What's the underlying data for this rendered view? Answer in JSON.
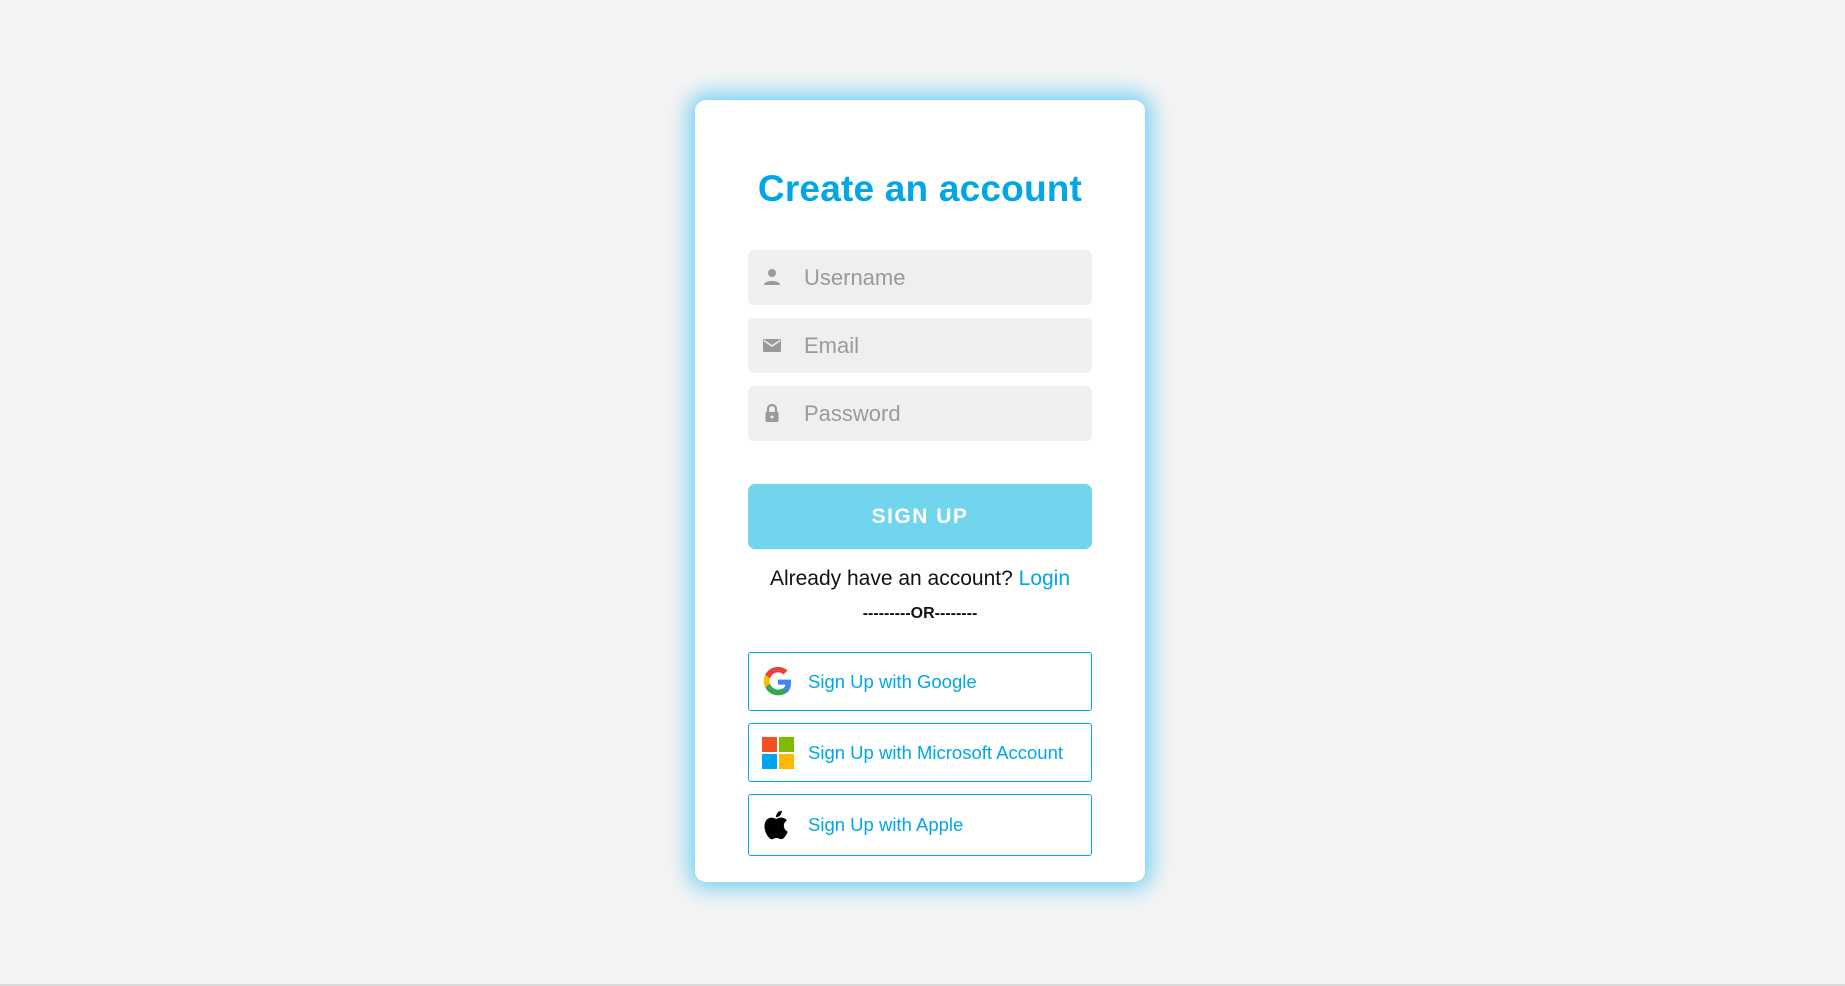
{
  "form": {
    "title": "Create an account",
    "fields": [
      {
        "placeholder": "Username",
        "value": "",
        "icon": "person-icon"
      },
      {
        "placeholder": "Email",
        "value": "",
        "icon": "envelope-icon"
      },
      {
        "placeholder": "Password",
        "value": "",
        "icon": "lock-icon"
      }
    ],
    "submit_label": "SIGN UP",
    "login_prompt": "Already have an account?",
    "login_link": "Login",
    "divider": "---------OR--------"
  },
  "social": [
    {
      "label": "Sign Up with Google",
      "icon": "google-icon"
    },
    {
      "label": "Sign Up with Microsoft Account",
      "icon": "microsoft-icon"
    },
    {
      "label": "Sign Up with Apple",
      "icon": "apple-icon"
    }
  ],
  "colors": {
    "accent": "#00a7e8",
    "button": "#72d5ee",
    "background": "#f4f4f4",
    "field_background": "#efefef"
  }
}
